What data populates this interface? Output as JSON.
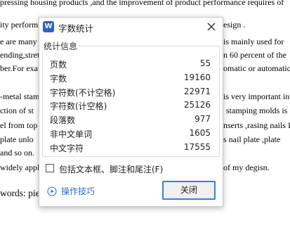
{
  "document": {
    "lines": [
      "pressing housing products ,and the improvement of product performance requires of",
      "ity perform",
      "e are many",
      "ending,stret",
      "ber.For exa",
      "-metal stam",
      "ction of st",
      "el from top",
      "plate unlo",
      "and so on.",
      "widely appli"
    ],
    "right_texts": [
      "esign .",
      "is mainly used for",
      "n 60 percent of the",
      "omatic or automatic",
      "is very important in",
      "stamping molds is",
      "nserts ,rasing nails I",
      "s nail plate ,plate",
      "of my degisn."
    ],
    "keywords_line": "words: pie"
  },
  "dialog": {
    "title": "字数统计",
    "logo_letter": "W",
    "group_title": "统计信息",
    "stats": [
      {
        "label": "页数",
        "value": "55"
      },
      {
        "label": "字数",
        "value": "19160"
      },
      {
        "label": "字符数(不计空格)",
        "value": "22971"
      },
      {
        "label": "字符数(计空格)",
        "value": "25126"
      },
      {
        "label": "段落数",
        "value": "977"
      },
      {
        "label": "非中文单词",
        "value": "1605"
      },
      {
        "label": "中文字符",
        "value": "17555"
      }
    ],
    "checkbox_label": "包括文本框、脚注和尾注(F)",
    "tips_label": "操作技巧",
    "close_button_label": "关闭"
  },
  "colors": {
    "logo_bg": "#2b62c9",
    "link": "#2a6bd1",
    "button_focus_border": "#3b7fe0"
  }
}
